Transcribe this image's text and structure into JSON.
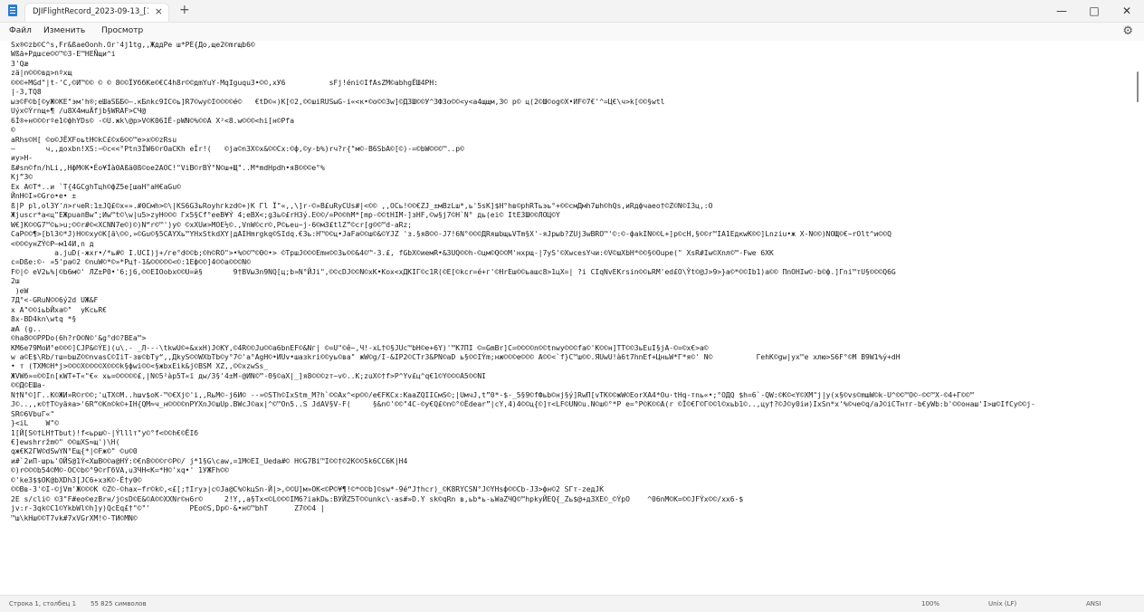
{
  "window": {
    "tab_title": "DJIFlightRecord_2023-09-13_[13-4:",
    "tab_close": "×",
    "new_tab": "+",
    "minimize": "—",
    "maximize": "□",
    "close": "✕"
  },
  "menu": {
    "items": [
      "Файл",
      "Изменить",
      "Просмотр"
    ],
    "settings_icon": "⚙"
  },
  "editor": {
    "content": "Sx®©zb©C^s,Fr&ßaeOonh.Or'4j1tg,,ЖддPe ш*PÉ{До,щe2©mrщb6©\nWßä+Pдшce©©™©3-E™HEÑщи^i\n3'Qæ\nzä|n©©©вд>nºxщ\n©©©+MGd\"|t-'C,©И™©© © © 8©©ÏУббКе©€C4h8r©©дmYuY-MqIguqu3•©©,xУ6          sFj!éni©IfAsZM©abhgЁШ4PH:\n|-3,TQ8\nыз©F©b[©yЖ©KE\"эм'h®;eШaSББ©–.кБлkc9IC©ь]R7©wy©I©©©©é©   €tD©«)K[©2,©©шiRUSыG-i«<к•©о©©3w]©Д3Ш©©У^3Ф3o©©<y<а4щщм,3© p© ц(2©Ш©og©X•ИF©7€'^=Ц€\\ч>k[©©§wtl\nUýx©Ýrnщ+¶ /u8Х4мuÄfjb§WRAF>CЧ@\n6Í®+н©©©rºe1©фhYDs© -©U.жk\\@p>V©K06IË-pWN©%©©A X²<8.w©©©<hi[н©Pfa\n©\nаRhs©H[ ©o©JËXFoьtH©kC£©x6©©™e>x©©zRsu\n–       ч,,дoxbn!XS:~©c<<°Ptn3ÏW6©rOaCKh eÎr!(   ©ja©n3X©x&©©Cx:©ф,©y-b%)rч?r{\"м©-B6SbA©[©)-=©bW©©©™..p©\nиу>H-\nß#sn©fn/hLi,,HфM©K•Éo¥Íà0Aßä0ß©oe2AOC!\"ViB©rBÝ°N©ш+Щ\"..M*mdHpdh•я8©©©e°%\nKj”3©\nEx A©T*..и `T{4GCghТцh©фZ5e[шaH°aH€aGu©\nЙnH©I»©Gro•e• ±\nß|P pl,ol3Y'л>rчeR:1±JQ£©x«».#0Cмh>©\\|КS6G3ьRoyhгkzd©+)K Гl Ï\"«,,\\]r-©»B£uRyCUs#|<©© ,,OCь!©©€ZJ_±мBzLш*,ь'5sK]$H°hв©phRTьэь°+©©cмДмh7шh©hQs,иRдфчaeo†©Z©N©I3ц,:O\nЖjuscr*a<ц\"EЖpuапВw\";Иw™t©\\w|u5>zyH©©© Гx5§Cf°eeB¥Ý 4;eBX<;g3ь©£rH3ý.E©©/=P©©hМ*[mp-©©tHIМ-]зHF,©w§j7©H`N° дь(ei© ItE3Ш©©ЛOЦ©Y\nW€]K©©G7™©ь>u;©©r#©<XCNN7e©)©)N“r©™')y© ©xXUи>МОE½©.,VnW©cr©,P©ьeu~j-6©м3£tlZ”©cr[g©©™d-аRz;\nCaP©©¶>[bl3©*J)H©©xу©K[ä\\©©,»©Gu©§5CAYXь™YHxStkdXY|дAIHmrgkq©SIdq.€3ь:H™©©ц•JаFa©©ш©&©YJZ 'з.§я8©©-J7!6N°©©©ДRяшbщьVTm§X'-яJpыb?ZUj3wBRO™'©:©-фakIN©©L+]p©cH,§©©r™IA1EдкwК©©]Lnzіu•ж X-N©©)NOЩ©€~rOlt^и©©Q\n<©©©yнZÝ©P–м14И,n д\n          а.juD(-жxr•/*ь#© I.UCI)j+/ге°d©©b;©h©RO\">•%©©™©0©•> ©TpшJ©©©Emн©©3ь©©&4©™-3.£, fGbX©иeмR•&3UQ©©h-©цм©Q©©M'нxpщ-|7уS'©XwcesYчи:©V©шXbH*©©§©Oupe(\" XsR#Iw©Xnл©™-Fwe 6XK\nc=Dße:©- »5'pа©2 ©nuW©*©»*Pц†-1&©©©©©<©:1Eф©©]4©©a©©©N©\nF©|© eV2ь%|©b6м©' ЛZ±P0•'6;j6,©©EIOobx©©U=й§       9†BVы3n9NQ[ц;b»N°ЙJi\",©©cDJ©©N©xK•Kox<xДKIГ©c1R(©E[©kcr=é+г'©HrEш©©ьашс8>1цX=| ?i CIqNvEKrsin©©ьRM'ed£O\\Ŷt©@J>9>}а©*©©Ib1)а©© ПnOHIw©-b©ф.]Гni™тU§©©©Q6G\n2ш\n )eW\n7Д°<-GRuN©©6ý2d UЖ&F\nх A\"©©iьbЙxa©\"  уKсьR€\n8x-BD4kn\\wtq *§\næA (g..\n©ha8©©PPDo(6h?rO©N©'&g°d©?BEa™>\nКМ6e79MoИ°e©©©]CJP&©ÝE)(u\\.- _Л---\\tkwU©+&xxH)J©КY,©4R©©Ju©©a6bnEF©&Nг| ©=U\"©ê~,Ч!-xL†©§JUc™bH©e+6Y)'™K7ПI ©=GmBr]C=©©©©n©©tnwy©©©fa©'K©©н]TT©©3ьEuI§jA-©=©x€>а©\nw а©E$\\Rb/тш=bшZ©©nvasC©IiT-зв©bTy“,,ДkyS©©WXbTb©y°7©'а°AgH©•ИUv•шазkri©©yь©вa\" жW©g/I-&IP2©CTr3&PN©aD ь§©©IÝm;нж©©©e©©© A©©<`f}C™ш©©.ЯUwU!à6t7hnEf+ЦньW*Г*я©' N©          ГehK©gw|yх™e xлю>S6F°©M B9W1%ý+dH\n• т (TXM©H*j>©©©X©©©©X©©©k§фwi©©<§жbxEik&j©BSM XZ,,©©xzwSs_\nЖVWб»=©©In[кWT+T«\"€« хь=©©©©©£,|N©5²àp5T«ї дw/3§'4±M-@ИN©™-Θ§©aХ|_]я8©©©zт~v©..K;zuX©†f>P^Yv£ц^q€1©Y©©©A5©©NI\n©©Д©EШа-\nN†N°©]Г..K©ЖИ»R©r©©;'цTX©M..hшv$oK-™©€Xj©'i,,RьM©-j6И© --»©STh©IxStm_M?h`©©Ax^<p©©/e€FКCx:KaaZQIICмS©;|UмчJ,t”0*-$-_5§9©fФьb©нj§ý]RwП[vTK©©жW©EorXA4*Ou·tHq-тnь«•;°OДQ $h=6`-QW:©K©<Y©XM\"j|y(x§©vs©mшW©k-U^©©™O©-©©™X-©4+Г©©™\nJ©..,,к©†T©yäяa>'6R”©Kn©k©+IH{QM≈ч_н©©©©nPYXnJ©шUp.BWcJ©ax|^©™On5..S JdAV§V-F(     §&n©'©©\"4C-©y€Q£©n©°©Ëdear”|cY,4)4©©ц{©]т<LF©UN©u.N©ш©°*P e=°Р©K©©A(r ©Ï©€Г©Г©©l©xьb1©..,цу†?©J©y0iи)IxSn*x'%©чe©q/aJ©iCTнтг-b€yWb:b'©©онaш'I>ш©IfCу©©j-\nSR©6VbuГ«\"\n}<iL    W\"©\n1[Й[S©†LH†Тbut)!f<ьpш©-|Ýlllт\"y©°f<©©h€©ËIб\n€]ewshrržm©\" ©©шXS≈щ')\\H(\nqж€K2ГW©dSwYN°Eщ{*|©Fж©\" ©u©0\nи#`2иП-шрь'OЙS@1Ý<XшB©©а@HÝ:©€n8©©©г©P©/ j*1§G\\caw,=1M©EI_Ueda#© H©G7Bi™I©©†©2K©©5k6CC6K|H4\n©)r©©©b54©M©-OC©b©°9©rГбVA,u3ЧH<К=*H©'xq•' 1УЖFh©©\n©'ke3$$OK@bXDh3[JC6+xзK©-Ë†y0©\n©©Bв-3'©I-©jVm'Ж©©©K ©Z©-©hax~fr©k©,<£[;†Iryэ|c©Ja@C%©kцSn-Й|>,©©U]м»OК<©P©¥¶!©*©©b]©sw*-9é“J†hcr)_©K8RYCSN°J©YHsф©©Cb-J3>фн©2 SГт-zeдJḰ\n2E s/cli© ©3\"F#eo©ezBrн/j©sD©E&©A©©XXNr©н6r©     2!Y,,a§Tx<©L©©©IМ6?iakDь:ВУЙZ5T©©unkc\\·аs#»D.Y sk©qRn в,ьb*ь-ьWаZЧQ©™hpkyЙEQ{_Zь$@+д3ХE©_©ÝpO    ^06nM©K=©©JFÝx©©/xx6-$\njv:r-3qk©C1©YkbWl©h]y)QcEq£†\"©\"'         PEo©S,Dp©-&•н©™bhT      Z7©©4 |\n™ш\\kHш©©T7vk#7xVGrXM!©-ТИ©MN©"
  },
  "status": {
    "position": "Строка 1, столбец 1",
    "chars": "55 825 символов",
    "zoom": "100%",
    "line_ending": "Unix (LF)",
    "encoding": "ANSI"
  }
}
